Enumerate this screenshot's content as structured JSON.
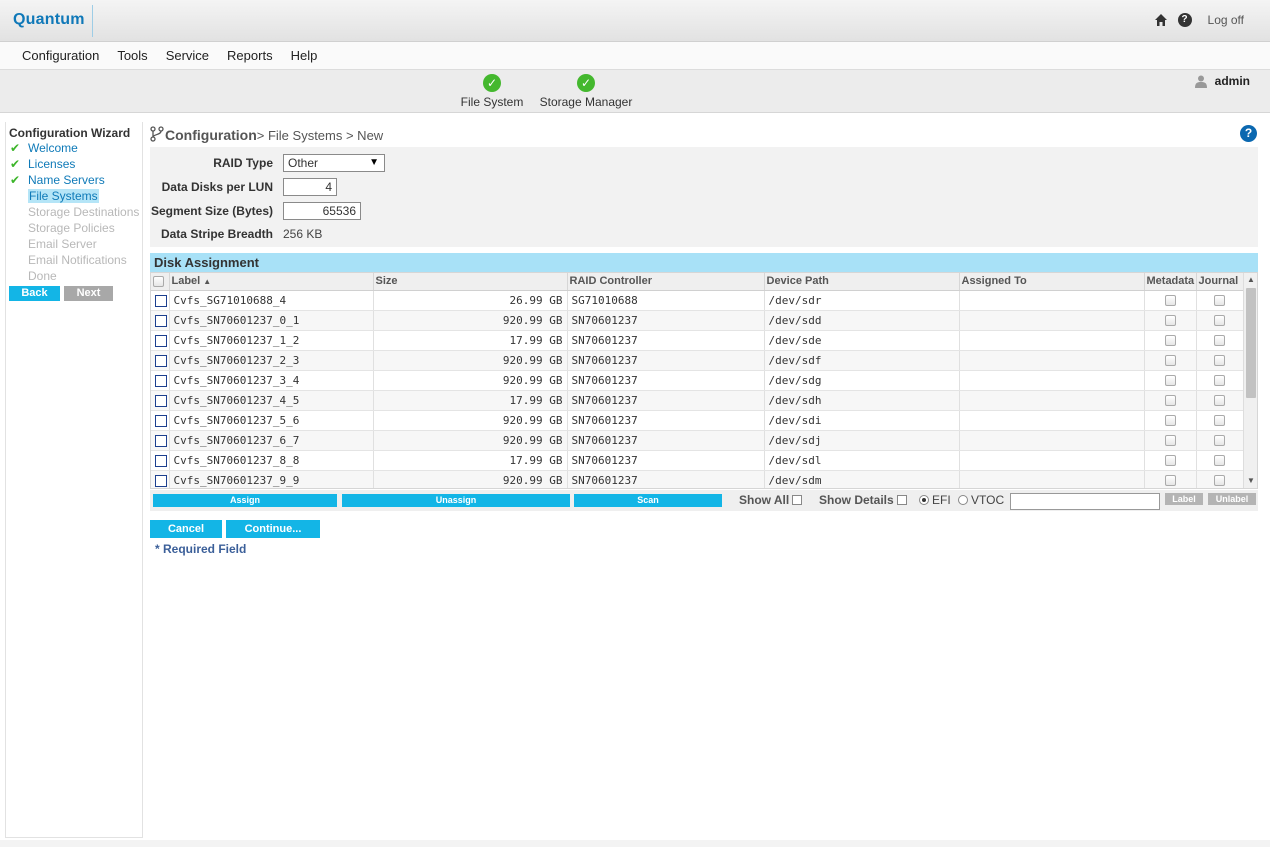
{
  "header": {
    "logo": "Quantum",
    "logoff_label": "Log off",
    "help_glyph": "?"
  },
  "menu": [
    "Configuration",
    "Tools",
    "Service",
    "Reports",
    "Help"
  ],
  "progress": {
    "steps": [
      {
        "label": "File System",
        "status": "complete"
      },
      {
        "label": "Storage Manager",
        "status": "complete"
      }
    ],
    "user": "admin"
  },
  "sidebar": {
    "title": "Configuration Wizard",
    "items": [
      {
        "label": "Welcome",
        "state": "done"
      },
      {
        "label": "Licenses",
        "state": "done"
      },
      {
        "label": "Name Servers",
        "state": "done"
      },
      {
        "label": "File Systems",
        "state": "current"
      },
      {
        "label": "Storage Destinations",
        "state": "disabled"
      },
      {
        "label": "Storage Policies",
        "state": "disabled"
      },
      {
        "label": "Email Server",
        "state": "disabled"
      },
      {
        "label": "Email Notifications",
        "state": "disabled"
      },
      {
        "label": "Done",
        "state": "disabled"
      }
    ],
    "back_label": "Back",
    "next_label": "Next"
  },
  "breadcrumb": {
    "head": "Configuration",
    "rest": "> File Systems > New"
  },
  "form": {
    "raid_type_label": "RAID Type",
    "raid_type_value": "Other",
    "data_disks_label": "Data Disks per LUN",
    "data_disks_value": "4",
    "segment_size_label": "Segment Size (Bytes)",
    "segment_size_value": "65536",
    "stripe_breadth_label": "Data Stripe Breadth",
    "stripe_breadth_value": "256 KB"
  },
  "disk_assignment": {
    "title": "Disk Assignment",
    "columns": {
      "label": "Label",
      "size": "Size",
      "raid_controller": "RAID Controller",
      "device_path": "Device Path",
      "assigned_to": "Assigned To",
      "metadata": "Metadata",
      "journal": "Journal"
    },
    "rows": [
      {
        "label": "Cvfs_SG71010688_4",
        "size": "26.99 GB",
        "controller": "SG71010688",
        "path": "/dev/sdr",
        "assigned": ""
      },
      {
        "label": "Cvfs_SN70601237_0_1",
        "size": "920.99 GB",
        "controller": "SN70601237",
        "path": "/dev/sdd",
        "assigned": ""
      },
      {
        "label": "Cvfs_SN70601237_1_2",
        "size": "17.99 GB",
        "controller": "SN70601237",
        "path": "/dev/sde",
        "assigned": ""
      },
      {
        "label": "Cvfs_SN70601237_2_3",
        "size": "920.99 GB",
        "controller": "SN70601237",
        "path": "/dev/sdf",
        "assigned": ""
      },
      {
        "label": "Cvfs_SN70601237_3_4",
        "size": "920.99 GB",
        "controller": "SN70601237",
        "path": "/dev/sdg",
        "assigned": ""
      },
      {
        "label": "Cvfs_SN70601237_4_5",
        "size": "17.99 GB",
        "controller": "SN70601237",
        "path": "/dev/sdh",
        "assigned": ""
      },
      {
        "label": "Cvfs_SN70601237_5_6",
        "size": "920.99 GB",
        "controller": "SN70601237",
        "path": "/dev/sdi",
        "assigned": ""
      },
      {
        "label": "Cvfs_SN70601237_6_7",
        "size": "920.99 GB",
        "controller": "SN70601237",
        "path": "/dev/sdj",
        "assigned": ""
      },
      {
        "label": "Cvfs_SN70601237_8_8",
        "size": "17.99 GB",
        "controller": "SN70601237",
        "path": "/dev/sdl",
        "assigned": ""
      },
      {
        "label": "Cvfs_SN70601237_9_9",
        "size": "920.99 GB",
        "controller": "SN70601237",
        "path": "/dev/sdm",
        "assigned": ""
      }
    ],
    "actions": {
      "assign": "Assign",
      "unassign": "Unassign",
      "scan": "Scan",
      "show_all": "Show All",
      "show_details": "Show Details",
      "efi": "EFI",
      "vtoc": "VTOC",
      "selected_format": "EFI",
      "label_button": "Label",
      "unlabel_button": "Unlabel"
    }
  },
  "buttons": {
    "cancel": "Cancel",
    "continue": "Continue..."
  },
  "required_note": "* Required Field",
  "colors": {
    "accent": "#13b5e6",
    "brand": "#0f78b8",
    "success": "#44b82e",
    "section_header": "#a8e1f7"
  }
}
